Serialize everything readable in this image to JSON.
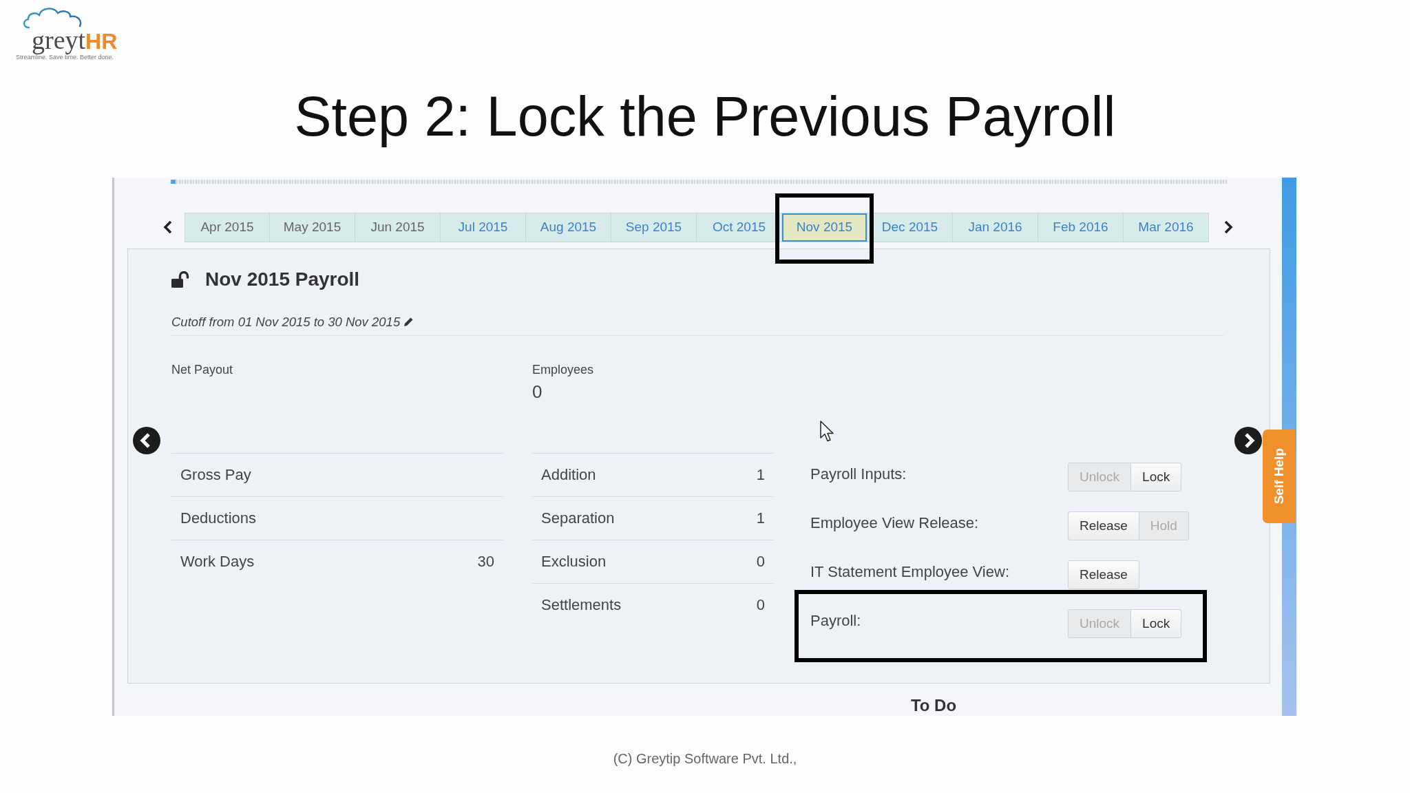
{
  "logo": {
    "wordmark": "greyt",
    "wordmark_accent": "HR",
    "tagline": "Streamline. Save time. Better done."
  },
  "slide_title": "Step 2: Lock the Previous Payroll",
  "month_tabs": [
    {
      "label": "Apr 2015",
      "selected": false,
      "disabled": true,
      "highlighted": false
    },
    {
      "label": "May 2015",
      "selected": false,
      "disabled": true,
      "highlighted": false
    },
    {
      "label": "Jun 2015",
      "selected": false,
      "disabled": true,
      "highlighted": false
    },
    {
      "label": "Jul 2015",
      "selected": false,
      "disabled": false,
      "highlighted": false
    },
    {
      "label": "Aug 2015",
      "selected": false,
      "disabled": false,
      "highlighted": false
    },
    {
      "label": "Sep 2015",
      "selected": false,
      "disabled": false,
      "highlighted": false
    },
    {
      "label": "Oct 2015",
      "selected": false,
      "disabled": false,
      "highlighted": false
    },
    {
      "label": "Nov 2015",
      "selected": true,
      "disabled": false,
      "highlighted": true
    },
    {
      "label": "Dec 2015",
      "selected": false,
      "disabled": false,
      "highlighted": false
    },
    {
      "label": "Jan 2016",
      "selected": false,
      "disabled": false,
      "highlighted": false
    },
    {
      "label": "Feb 2016",
      "selected": false,
      "disabled": false,
      "highlighted": false
    },
    {
      "label": "Mar 2016",
      "selected": false,
      "disabled": false,
      "highlighted": false
    }
  ],
  "payroll": {
    "title": "Nov 2015 Payroll",
    "locked": false,
    "cutoff": "Cutoff from 01 Nov 2015 to 30 Nov 2015",
    "net_payout_label": "Net Payout",
    "employees_label": "Employees",
    "employees_value": "0"
  },
  "summary": [
    {
      "label": "Gross Pay"
    },
    {
      "label": "Deductions"
    },
    {
      "label": "Work Days",
      "value": "30"
    }
  ],
  "changes": [
    {
      "label": "Addition",
      "value": "1"
    },
    {
      "label": "Separation",
      "value": "1"
    },
    {
      "label": "Exclusion",
      "value": "0"
    },
    {
      "label": "Settlements",
      "value": "0"
    }
  ],
  "controls": [
    {
      "label": "Payroll Inputs:",
      "highlighted": false,
      "buttons": [
        {
          "label": "Unlock",
          "disabled": true
        },
        {
          "label": "Lock",
          "disabled": false
        }
      ]
    },
    {
      "label": "Employee View Release:",
      "highlighted": false,
      "buttons": [
        {
          "label": "Release",
          "disabled": false
        },
        {
          "label": "Hold",
          "disabled": true
        }
      ]
    },
    {
      "label": "IT Statement Employee View:",
      "highlighted": false,
      "buttons": [
        {
          "label": "Release",
          "disabled": false
        }
      ]
    },
    {
      "label": "Payroll:",
      "highlighted": true,
      "buttons": [
        {
          "label": "Unlock",
          "disabled": true
        },
        {
          "label": "Lock",
          "disabled": false
        }
      ]
    }
  ],
  "self_help": "Self Help",
  "section_heading": "To Do",
  "footer": "(C) Greytip Software Pvt. Ltd.,"
}
